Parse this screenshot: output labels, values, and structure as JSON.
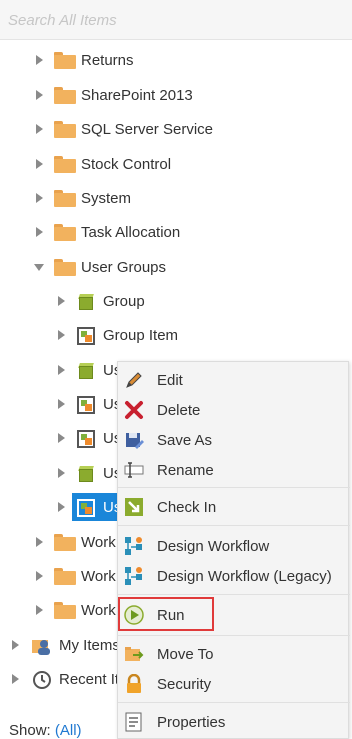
{
  "search": {
    "placeholder": "Search All Items"
  },
  "tree": {
    "folders_top": [
      {
        "label": "Returns"
      },
      {
        "label": "SharePoint 2013"
      },
      {
        "label": "SQL Server Service"
      },
      {
        "label": "Stock Control"
      },
      {
        "label": "System"
      },
      {
        "label": "Task Allocation"
      }
    ],
    "user_groups": {
      "label": "User Groups",
      "children": [
        {
          "label": "Group"
        },
        {
          "label": "Group Item"
        },
        {
          "label": "Us"
        },
        {
          "label": "Us"
        },
        {
          "label": "Us"
        },
        {
          "label": "Us"
        },
        {
          "label": "Us"
        }
      ]
    },
    "folders_bottom": [
      {
        "label": "Work"
      },
      {
        "label": "Work"
      },
      {
        "label": "Work"
      }
    ],
    "roots": [
      {
        "label": "My Items"
      },
      {
        "label": "Recent It"
      }
    ]
  },
  "footer": {
    "show_label": "Show:",
    "show_value": "(All)"
  },
  "context_menu": {
    "items": [
      {
        "label": "Edit",
        "icon": "pencil-icon"
      },
      {
        "label": "Delete",
        "icon": "delete-x-icon"
      },
      {
        "label": "Save As",
        "icon": "save-as-icon"
      },
      {
        "label": "Rename",
        "icon": "rename-icon"
      },
      {
        "label": "Check In",
        "icon": "check-in-icon"
      },
      {
        "label": "Design Workflow",
        "icon": "design-workflow-icon"
      },
      {
        "label": "Design Workflow (Legacy)",
        "icon": "design-workflow-legacy-icon"
      },
      {
        "label": "Run",
        "icon": "run-play-icon"
      },
      {
        "label": "Move To",
        "icon": "move-to-icon"
      },
      {
        "label": "Security",
        "icon": "lock-icon"
      },
      {
        "label": "Properties",
        "icon": "properties-icon"
      }
    ],
    "highlighted_item": "Run"
  },
  "colors": {
    "selection": "#1a86d9",
    "highlight_border": "#e03a3a",
    "folder": "#f2b25e",
    "link": "#1f78d1"
  }
}
